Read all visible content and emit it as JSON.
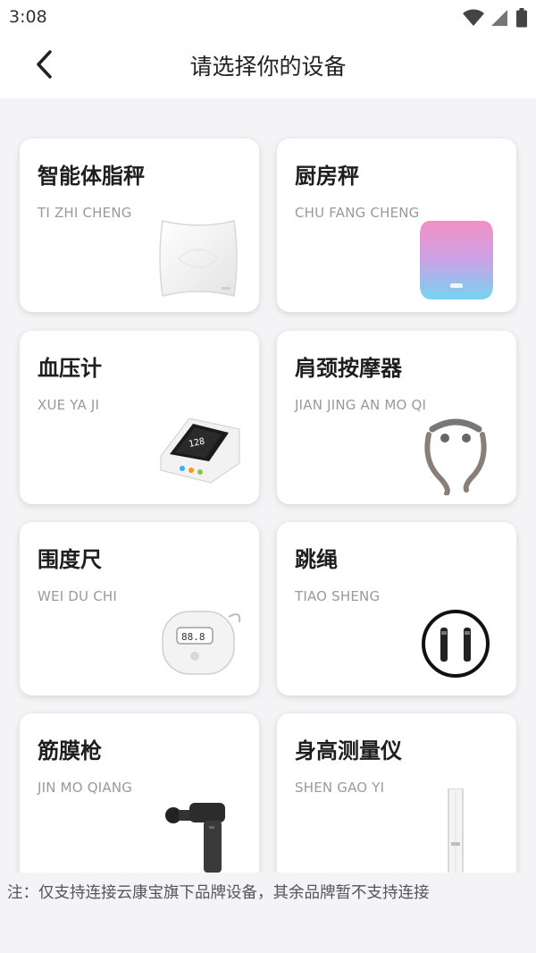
{
  "status_bar": {
    "time": "3:08",
    "icons": [
      "wifi-icon",
      "signal-icon",
      "battery-icon"
    ]
  },
  "header": {
    "back_icon": "chevron-left-icon",
    "title": "请选择你的设备"
  },
  "devices": [
    {
      "name": "智能体脂秤",
      "pinyin": "TI ZHI CHENG",
      "image": "body-fat-scale-image"
    },
    {
      "name": "厨房秤",
      "pinyin": "CHU FANG CHENG",
      "image": "kitchen-scale-image"
    },
    {
      "name": "血压计",
      "pinyin": "XUE YA JI",
      "image": "blood-pressure-monitor-image"
    },
    {
      "name": "肩颈按摩器",
      "pinyin": "JIAN JING AN MO QI",
      "image": "neck-massager-image"
    },
    {
      "name": "围度尺",
      "pinyin": "WEI DU CHI",
      "image": "tape-measure-image"
    },
    {
      "name": "跳绳",
      "pinyin": "TIAO SHENG",
      "image": "jump-rope-image"
    },
    {
      "name": "筋膜枪",
      "pinyin": "JIN MO QIANG",
      "image": "massage-gun-image"
    },
    {
      "name": "身高测量仪",
      "pinyin": "SHEN GAO YI",
      "image": "height-meter-image"
    }
  ],
  "footer": {
    "note": "注：仅支持连接云康宝旗下品牌设备，其余品牌暂不支持连接"
  }
}
